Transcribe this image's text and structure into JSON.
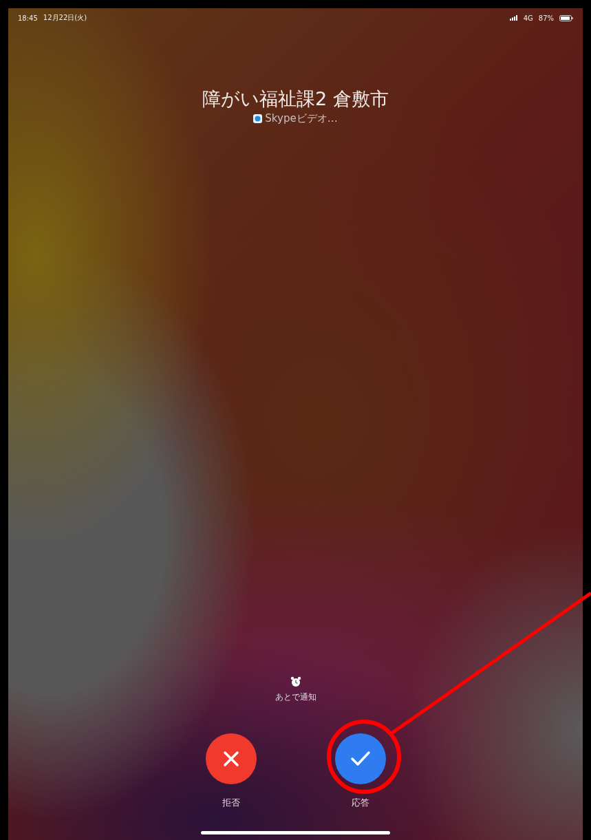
{
  "status_bar": {
    "time": "18:45",
    "date": "12月22日(火)",
    "network": "4G",
    "battery": "87%"
  },
  "caller": {
    "name": "障がい福祉課2 倉敷市",
    "app": "Skypeビデオ…"
  },
  "remind_later": {
    "label": "あとで通知"
  },
  "actions": [
    {
      "kind": "decline",
      "label": "拒否"
    },
    {
      "kind": "accept",
      "label": "応答"
    }
  ],
  "annotation": {
    "kind": "callout"
  }
}
